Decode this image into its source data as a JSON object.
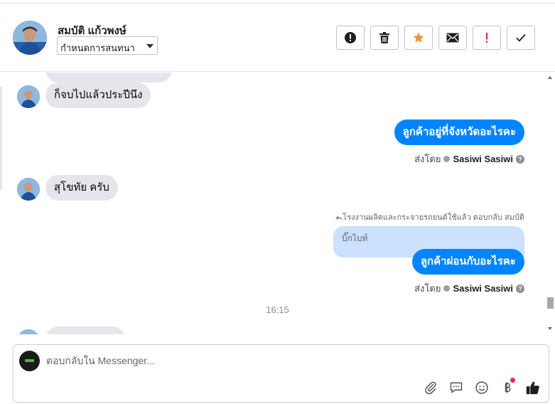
{
  "header": {
    "contact_name": "สมบัติ แก้วพงษ์",
    "assign_label": "กำหนดการสนทนา",
    "actions": [
      {
        "name": "mark-spam-button",
        "icon": "exclamation-circle-icon"
      },
      {
        "name": "delete-button",
        "icon": "trash-icon"
      },
      {
        "name": "star-button",
        "icon": "star-icon"
      },
      {
        "name": "mark-unread-button",
        "icon": "envelope-icon"
      },
      {
        "name": "follow-up-button",
        "icon": "exclamation-icon"
      },
      {
        "name": "mark-done-button",
        "icon": "checkmark-icon"
      }
    ]
  },
  "messages": {
    "in_1": "ก็จบไปแล้วประปีนึง",
    "out_1": "ลูกค้าอยู่ที่จังหวัดอะไรคะ",
    "sent_by_label": "ส่งโดย",
    "sender": "Sasiwi Sasiwi",
    "in_2": "สุโขทัย ครับ",
    "reply_meta": "โรงงานผลิตและกระจายรถยนต์ใช้แล้ว ตอบกลับ สมบัติ",
    "quoted_text": "บิ๊กไบท์",
    "out_2": "ลูกค้าผ่อนกับอะไรคะ",
    "time": "16:15"
  },
  "composer": {
    "placeholder": "ตอบกลับใน Messenger...",
    "icons": [
      "paperclip-icon",
      "saved-replies-icon",
      "emoji-icon",
      "baht-payment-icon",
      "thumbs-up-icon"
    ]
  },
  "colors": {
    "accent": "#0084ff",
    "incoming_bubble": "#e4e6eb",
    "quoted_bubble": "#cce0ff",
    "star": "#f7923a",
    "alert_red": "#e41e3f"
  }
}
